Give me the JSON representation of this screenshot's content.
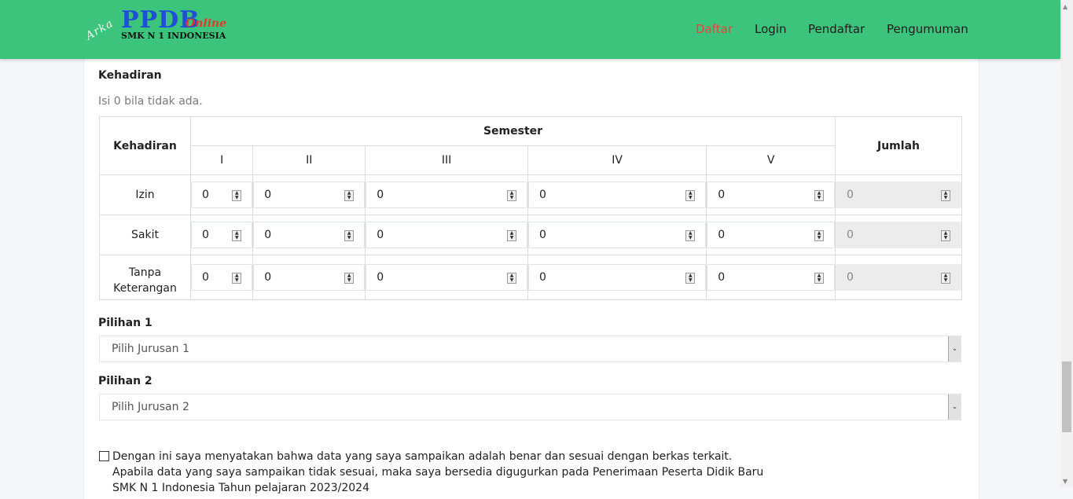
{
  "nav": {
    "logo": {
      "script": "Arka",
      "main": "PPDB",
      "online": "Online",
      "sub": "SMK N 1 INDONESIA"
    },
    "items": [
      "Daftar",
      "Login",
      "Pendaftar",
      "Pengumuman"
    ],
    "active_color": "#e6463c",
    "bar_color": "#3cc47c"
  },
  "attendance": {
    "title": "Kehadiran",
    "hint": "Isi 0 bila tidak ada.",
    "header": {
      "col1": "Kehadiran",
      "semester": "Semester",
      "total": "Jumlah"
    },
    "semesters": [
      "I",
      "II",
      "III",
      "IV",
      "V"
    ],
    "rows": [
      {
        "label": "Izin",
        "values": [
          "0",
          "0",
          "0",
          "0",
          "0"
        ],
        "total": "0"
      },
      {
        "label": "Sakit",
        "values": [
          "0",
          "0",
          "0",
          "0",
          "0"
        ],
        "total": "0"
      },
      {
        "label": "Tanpa Keterangan",
        "values": [
          "0",
          "0",
          "0",
          "0",
          "0"
        ],
        "total": "0"
      }
    ]
  },
  "choices": {
    "first": {
      "label": "Pilihan 1",
      "placeholder": "Pilih Jurusan 1"
    },
    "second": {
      "label": "Pilihan 2",
      "placeholder": "Pilih Jurusan 2"
    }
  },
  "declaration": {
    "line1": "Dengan ini saya menyatakan bahwa data yang saya sampaikan adalah benar dan sesuai dengan berkas terkait.",
    "line2": "Apabila data yang saya sampaikan tidak sesuai, maka saya bersedia digugurkan pada Penerimaan Peserta Didik Baru",
    "line3": "SMK N 1 Indonesia Tahun pelajaran 2023/2024"
  }
}
